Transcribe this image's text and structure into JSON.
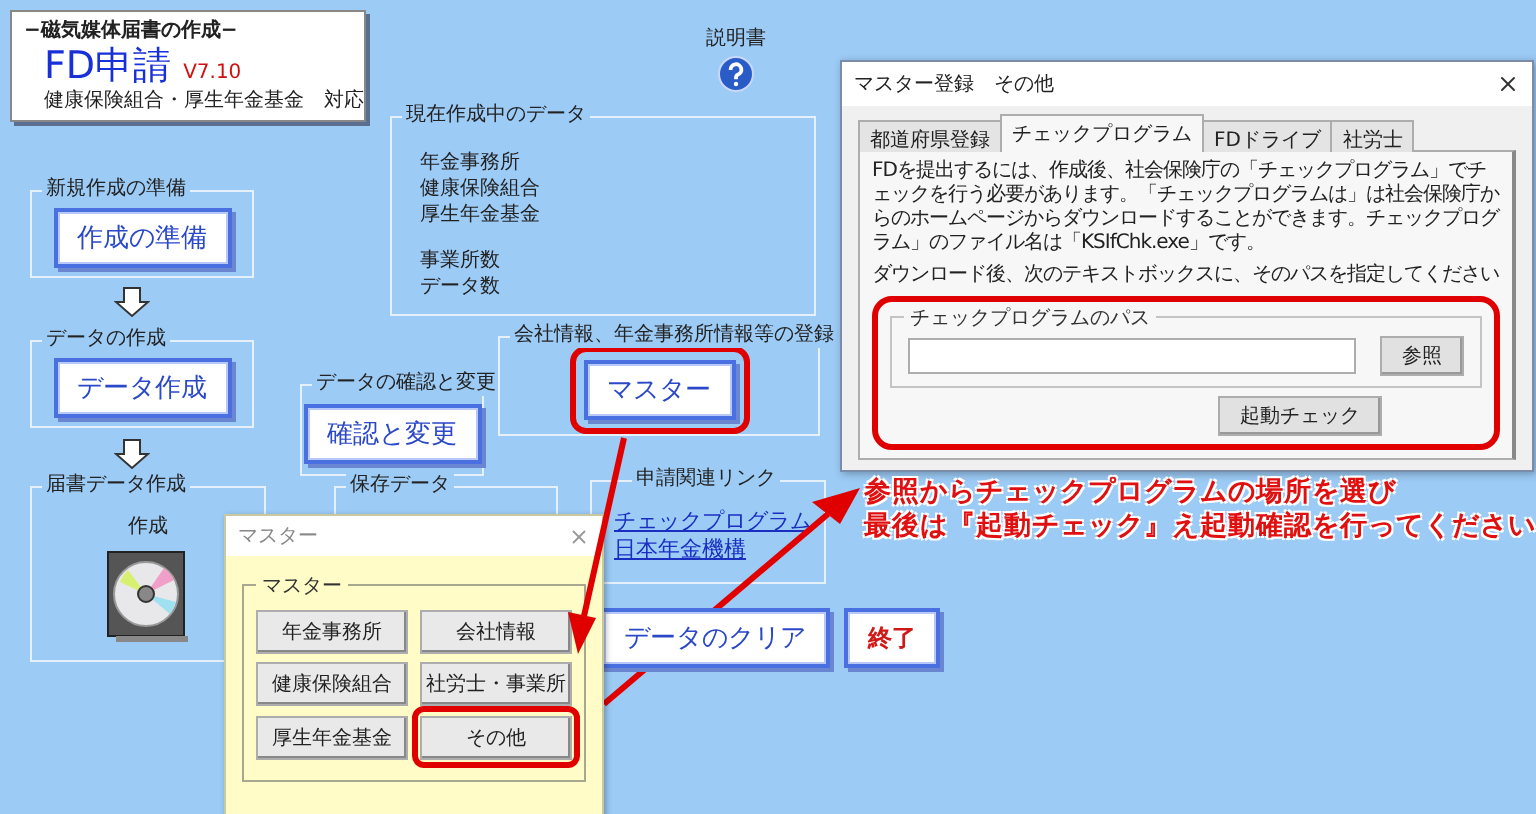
{
  "header": {
    "subtitle": "−磁気媒体届書の作成−",
    "title": "FD申請",
    "version": "V7.10",
    "note": "健康保険組合・厚生年金基金　対応"
  },
  "help": {
    "label": "説明書"
  },
  "current_data": {
    "title": "現在作成中のデータ",
    "items": [
      "年金事務所",
      "健康保険組合",
      "厚生年金基金"
    ],
    "counts": [
      "事業所数",
      "データ数"
    ]
  },
  "action_groups": [
    {
      "title": "新規作成の準備",
      "button": "作成の準備",
      "highlighted": false
    },
    {
      "title": "データの作成",
      "button": "データ作成",
      "highlighted": false
    },
    {
      "title": "データの確認と変更",
      "button": "確認と変更",
      "highlighted": false
    },
    {
      "title": "会社情報、年金事務所情報等の登録",
      "button": "マスター",
      "highlighted": true
    }
  ],
  "report_group": {
    "title": "届書データ作成",
    "caption": "作成"
  },
  "saved_group": {
    "title": "保存データ"
  },
  "links_group": {
    "title": "申請関連リンク",
    "links": [
      "チェックプログラム",
      "日本年金機構"
    ]
  },
  "bottom_buttons": [
    {
      "label": "データのクリア",
      "kind": "normal"
    },
    {
      "label": "終了",
      "kind": "exit"
    }
  ],
  "master_dialog": {
    "title": "マスター",
    "group": "マスター",
    "buttons": [
      {
        "label": "年金事務所",
        "highlighted": false
      },
      {
        "label": "会社情報",
        "highlighted": false
      },
      {
        "label": "健康保険組合",
        "highlighted": false
      },
      {
        "label": "社労士・事業所",
        "highlighted": false
      },
      {
        "label": "厚生年金基金",
        "highlighted": false
      },
      {
        "label": "その他",
        "highlighted": true
      }
    ]
  },
  "settings_dialog": {
    "title": "マスター登録　その他",
    "tabs": [
      {
        "label": "都道府県登録",
        "selected": false
      },
      {
        "label": "チェックプログラム",
        "selected": true
      },
      {
        "label": "FDドライブ",
        "selected": false
      },
      {
        "label": "社労士",
        "selected": false
      }
    ],
    "description": "FDを提出するには、作成後、社会保険庁の「チェックプログラム」でチェックを行う必要があります。「チェックプログラムは」は社会保険庁からのホームページからダウンロードすることができます。チェックプログラム」のファイル名は「KSIfChk.exe」です。",
    "instruction": "ダウンロード後、次のテキストボックスに、そのパスを指定してください",
    "path_group": "チェックプログラムのパス",
    "browse_button": "参照",
    "check_button": "起動チェック"
  },
  "annotation": {
    "lines": [
      "参照からチェックプログラムの場所を選び",
      "最後は『起動チェック』え起動確認を行ってください"
    ]
  }
}
